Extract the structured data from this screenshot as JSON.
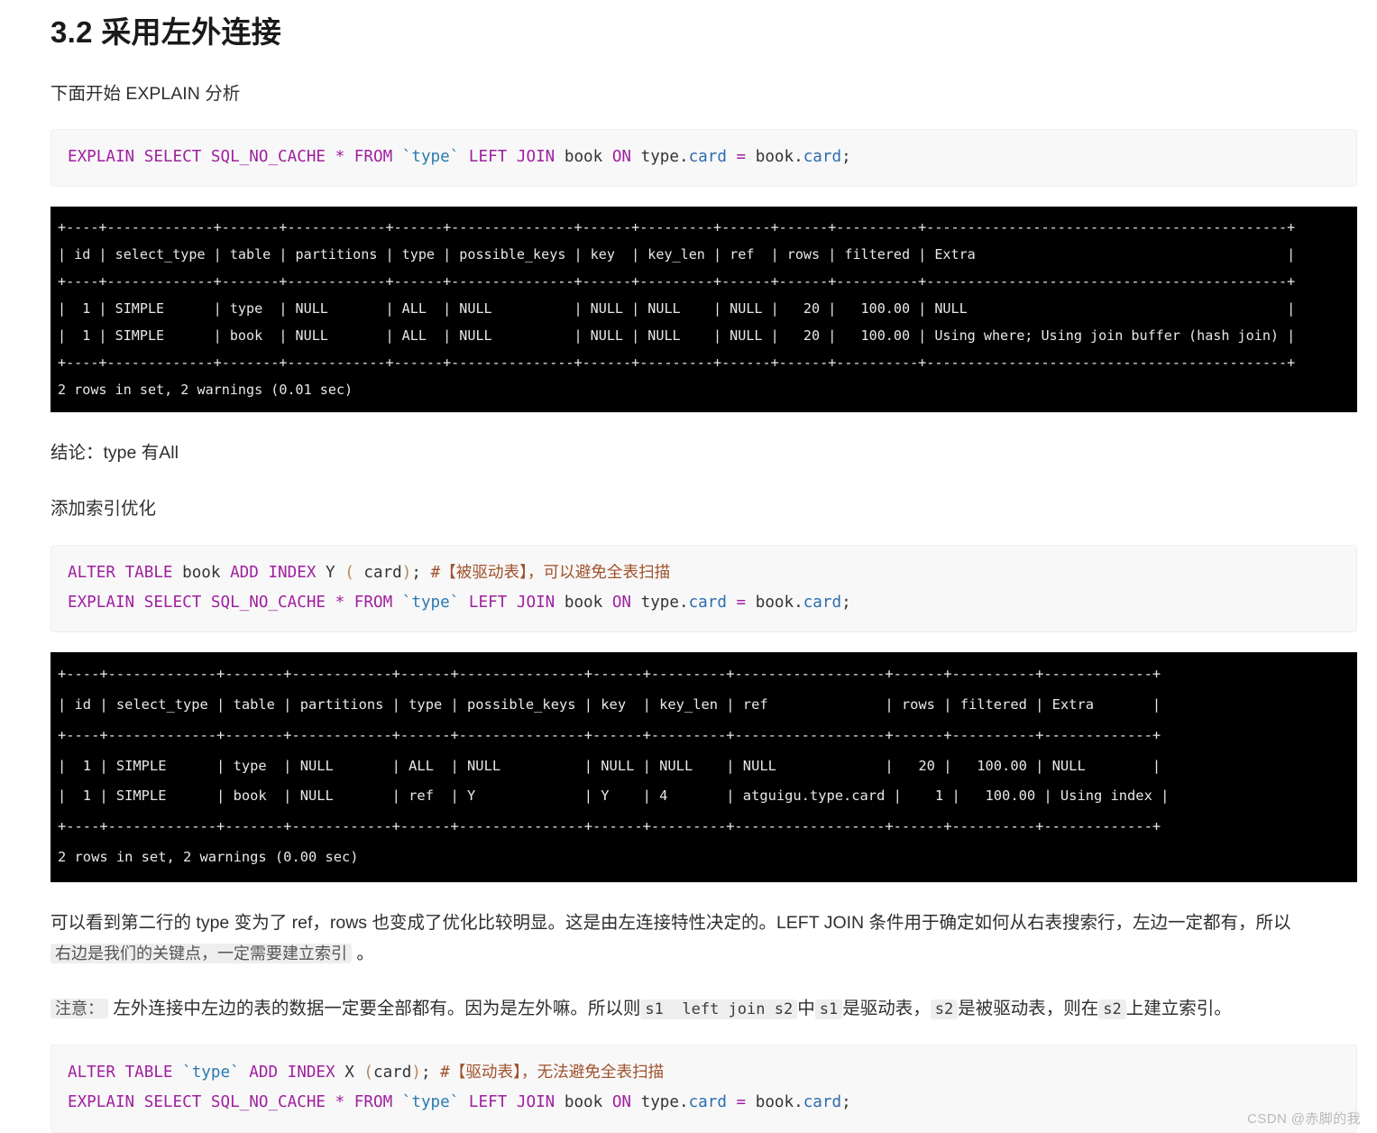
{
  "document": {
    "heading": "3.2 采用左外连接",
    "intro_paragraph": "下面开始 EXPLAIN 分析",
    "conclusion_paragraph": "结论：type 有All",
    "optimize_paragraph": "添加索引优化",
    "watermark": "CSDN @赤脚的我"
  },
  "code_block_1": {
    "lines": [
      {
        "tokens": [
          {
            "t": "EXPLAIN",
            "c": "kw"
          },
          {
            "t": " ",
            "c": "ident"
          },
          {
            "t": "SELECT",
            "c": "kw"
          },
          {
            "t": " ",
            "c": "ident"
          },
          {
            "t": "SQL_NO_CACHE",
            "c": "kw"
          },
          {
            "t": " ",
            "c": "ident"
          },
          {
            "t": "*",
            "c": "op"
          },
          {
            "t": " ",
            "c": "ident"
          },
          {
            "t": "FROM",
            "c": "kw"
          },
          {
            "t": " ",
            "c": "ident"
          },
          {
            "t": "`type`",
            "c": "bt"
          },
          {
            "t": " ",
            "c": "ident"
          },
          {
            "t": "LEFT",
            "c": "kw"
          },
          {
            "t": " ",
            "c": "ident"
          },
          {
            "t": "JOIN",
            "c": "kw"
          },
          {
            "t": " ",
            "c": "ident"
          },
          {
            "t": "book",
            "c": "ident"
          },
          {
            "t": " ",
            "c": "ident"
          },
          {
            "t": "ON",
            "c": "kw"
          },
          {
            "t": " ",
            "c": "ident"
          },
          {
            "t": "type",
            "c": "ident"
          },
          {
            "t": ".",
            "c": "ident"
          },
          {
            "t": "card",
            "c": "fld"
          },
          {
            "t": " ",
            "c": "ident"
          },
          {
            "t": "=",
            "c": "op"
          },
          {
            "t": " ",
            "c": "ident"
          },
          {
            "t": "book",
            "c": "ident"
          },
          {
            "t": ".",
            "c": "ident"
          },
          {
            "t": "card",
            "c": "fld"
          },
          {
            "t": ";",
            "c": "semi"
          }
        ]
      }
    ]
  },
  "terminal_1": {
    "lines": [
      "+----+-------------+-------+------------+------+---------------+------+---------+------+------+----------+--------------------------------------------+",
      "| id | select_type | table | partitions | type | possible_keys | key  | key_len | ref  | rows | filtered | Extra                                      |",
      "+----+-------------+-------+------------+------+---------------+------+---------+------+------+----------+--------------------------------------------+",
      "|  1 | SIMPLE      | type  | NULL       | ALL  | NULL          | NULL | NULL    | NULL |   20 |   100.00 | NULL                                       |",
      "|  1 | SIMPLE      | book  | NULL       | ALL  | NULL          | NULL | NULL    | NULL |   20 |   100.00 | Using where; Using join buffer (hash join) |",
      "+----+-------------+-------+------------+------+---------------+------+---------+------+------+----------+--------------------------------------------+",
      "2 rows in set, 2 warnings (0.01 sec)"
    ]
  },
  "code_block_2": {
    "lines": [
      {
        "tokens": [
          {
            "t": "ALTER",
            "c": "kw"
          },
          {
            "t": " ",
            "c": "ident"
          },
          {
            "t": "TABLE",
            "c": "kw"
          },
          {
            "t": " ",
            "c": "ident"
          },
          {
            "t": "book",
            "c": "ident"
          },
          {
            "t": " ",
            "c": "ident"
          },
          {
            "t": "ADD",
            "c": "kw"
          },
          {
            "t": " ",
            "c": "ident"
          },
          {
            "t": "INDEX",
            "c": "kw"
          },
          {
            "t": " ",
            "c": "ident"
          },
          {
            "t": "Y",
            "c": "ident"
          },
          {
            "t": " ",
            "c": "ident"
          },
          {
            "t": "(",
            "c": "paren"
          },
          {
            "t": " ",
            "c": "ident"
          },
          {
            "t": "card",
            "c": "ident"
          },
          {
            "t": ")",
            "c": "paren"
          },
          {
            "t": "; ",
            "c": "semi"
          },
          {
            "t": "#【被驱动表】，可以避免全表扫描",
            "c": "cmt"
          }
        ]
      },
      {
        "tokens": [
          {
            "t": "EXPLAIN",
            "c": "kw"
          },
          {
            "t": " ",
            "c": "ident"
          },
          {
            "t": "SELECT",
            "c": "kw"
          },
          {
            "t": " ",
            "c": "ident"
          },
          {
            "t": "SQL_NO_CACHE",
            "c": "kw"
          },
          {
            "t": " ",
            "c": "ident"
          },
          {
            "t": "*",
            "c": "op"
          },
          {
            "t": " ",
            "c": "ident"
          },
          {
            "t": "FROM",
            "c": "kw"
          },
          {
            "t": " ",
            "c": "ident"
          },
          {
            "t": "`type`",
            "c": "bt"
          },
          {
            "t": " ",
            "c": "ident"
          },
          {
            "t": "LEFT",
            "c": "kw"
          },
          {
            "t": " ",
            "c": "ident"
          },
          {
            "t": "JOIN",
            "c": "kw"
          },
          {
            "t": " ",
            "c": "ident"
          },
          {
            "t": "book",
            "c": "ident"
          },
          {
            "t": " ",
            "c": "ident"
          },
          {
            "t": "ON",
            "c": "kw"
          },
          {
            "t": " ",
            "c": "ident"
          },
          {
            "t": "type",
            "c": "ident"
          },
          {
            "t": ".",
            "c": "ident"
          },
          {
            "t": "card",
            "c": "fld"
          },
          {
            "t": " ",
            "c": "ident"
          },
          {
            "t": "=",
            "c": "op"
          },
          {
            "t": " ",
            "c": "ident"
          },
          {
            "t": "book",
            "c": "ident"
          },
          {
            "t": ".",
            "c": "ident"
          },
          {
            "t": "card",
            "c": "fld"
          },
          {
            "t": ";",
            "c": "semi"
          }
        ]
      }
    ]
  },
  "terminal_2": {
    "lines": [
      "+----+-------------+-------+------------+------+---------------+------+---------+------------------+------+----------+-------------+",
      "| id | select_type | table | partitions | type | possible_keys | key  | key_len | ref              | rows | filtered | Extra       |",
      "+----+-------------+-------+------------+------+---------------+------+---------+------------------+------+----------+-------------+",
      "|  1 | SIMPLE      | type  | NULL       | ALL  | NULL          | NULL | NULL    | NULL             |   20 |   100.00 | NULL        |",
      "|  1 | SIMPLE      | book  | NULL       | ref  | Y             | Y    | 4       | atguigu.type.card |    1 |   100.00 | Using index |",
      "+----+-------------+-------+------------+------+---------------+------+---------+------------------+------+----------+-------------+",
      "2 rows in set, 2 warnings (0.00 sec)"
    ]
  },
  "explanation": {
    "part1": "可以看到第二行的 type 变为了 ref，rows 也变成了优化比较明显。这是由左连接特性决定的。LEFT JOIN 条件用于确定如何从右表搜索行，左边一定都有，所以 ",
    "chip1": "右边是我们的关键点，一定需要建立索引",
    "part2": " 。"
  },
  "note": {
    "chip_label": "注意：",
    "text1": " 左外连接中左边的表的数据一定要全部都有。因为是左外嘛。所以则",
    "chip_sql": "s1  left join s2",
    "text2": "中",
    "chip_s1": "s1",
    "text3": "是驱动表，",
    "chip_s2a": "s2",
    "text4": "是被驱动表，则在",
    "chip_s2b": "s2",
    "text5": "上建立索引。"
  },
  "code_block_3": {
    "lines": [
      {
        "tokens": [
          {
            "t": "ALTER",
            "c": "kw"
          },
          {
            "t": " ",
            "c": "ident"
          },
          {
            "t": "TABLE",
            "c": "kw"
          },
          {
            "t": " ",
            "c": "ident"
          },
          {
            "t": "`type`",
            "c": "bt"
          },
          {
            "t": " ",
            "c": "ident"
          },
          {
            "t": "ADD",
            "c": "kw"
          },
          {
            "t": " ",
            "c": "ident"
          },
          {
            "t": "INDEX",
            "c": "kw"
          },
          {
            "t": " ",
            "c": "ident"
          },
          {
            "t": "X",
            "c": "ident"
          },
          {
            "t": " ",
            "c": "ident"
          },
          {
            "t": "(",
            "c": "paren"
          },
          {
            "t": "card",
            "c": "ident"
          },
          {
            "t": ")",
            "c": "paren"
          },
          {
            "t": "; ",
            "c": "semi"
          },
          {
            "t": "#【驱动表】，无法避免全表扫描",
            "c": "cmt"
          }
        ]
      },
      {
        "tokens": [
          {
            "t": "EXPLAIN",
            "c": "kw"
          },
          {
            "t": " ",
            "c": "ident"
          },
          {
            "t": "SELECT",
            "c": "kw"
          },
          {
            "t": " ",
            "c": "ident"
          },
          {
            "t": "SQL_NO_CACHE",
            "c": "kw"
          },
          {
            "t": " ",
            "c": "ident"
          },
          {
            "t": "*",
            "c": "op"
          },
          {
            "t": " ",
            "c": "ident"
          },
          {
            "t": "FROM",
            "c": "kw"
          },
          {
            "t": " ",
            "c": "ident"
          },
          {
            "t": "`type`",
            "c": "bt"
          },
          {
            "t": " ",
            "c": "ident"
          },
          {
            "t": "LEFT",
            "c": "kw"
          },
          {
            "t": " ",
            "c": "ident"
          },
          {
            "t": "JOIN",
            "c": "kw"
          },
          {
            "t": " ",
            "c": "ident"
          },
          {
            "t": "book",
            "c": "ident"
          },
          {
            "t": " ",
            "c": "ident"
          },
          {
            "t": "ON",
            "c": "kw"
          },
          {
            "t": " ",
            "c": "ident"
          },
          {
            "t": "type",
            "c": "ident"
          },
          {
            "t": ".",
            "c": "ident"
          },
          {
            "t": "card",
            "c": "fld"
          },
          {
            "t": " ",
            "c": "ident"
          },
          {
            "t": "=",
            "c": "op"
          },
          {
            "t": " ",
            "c": "ident"
          },
          {
            "t": "book",
            "c": "ident"
          },
          {
            "t": ".",
            "c": "ident"
          },
          {
            "t": "card",
            "c": "fld"
          },
          {
            "t": ";",
            "c": "semi"
          }
        ]
      }
    ]
  }
}
